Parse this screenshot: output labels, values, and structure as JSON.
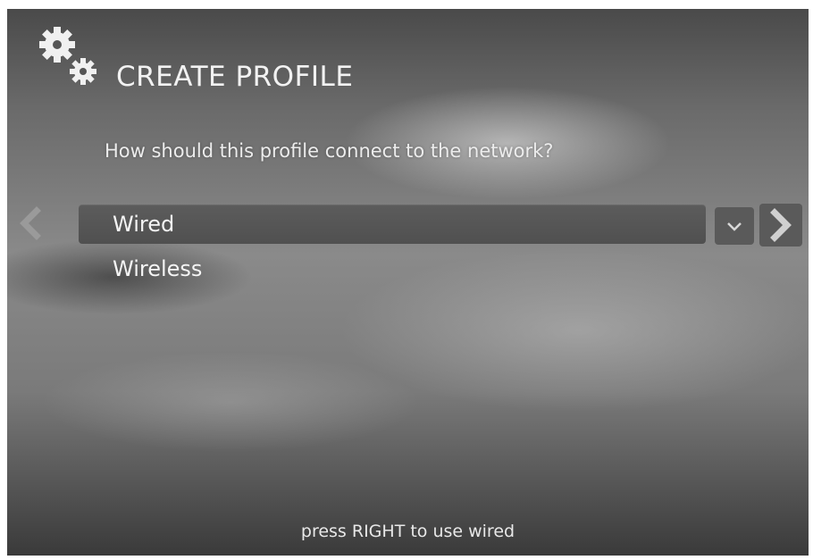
{
  "header": {
    "title": "CREATE PROFILE",
    "icon": "gears-icon"
  },
  "prompt": {
    "question": "How should this profile connect to the network?"
  },
  "options": [
    {
      "label": "Wired",
      "selected": true
    },
    {
      "label": "Wireless",
      "selected": false
    }
  ],
  "footer": {
    "hint": "press RIGHT to use wired"
  },
  "colors": {
    "selected_row": "#555555",
    "text": "#f4f4f4"
  }
}
